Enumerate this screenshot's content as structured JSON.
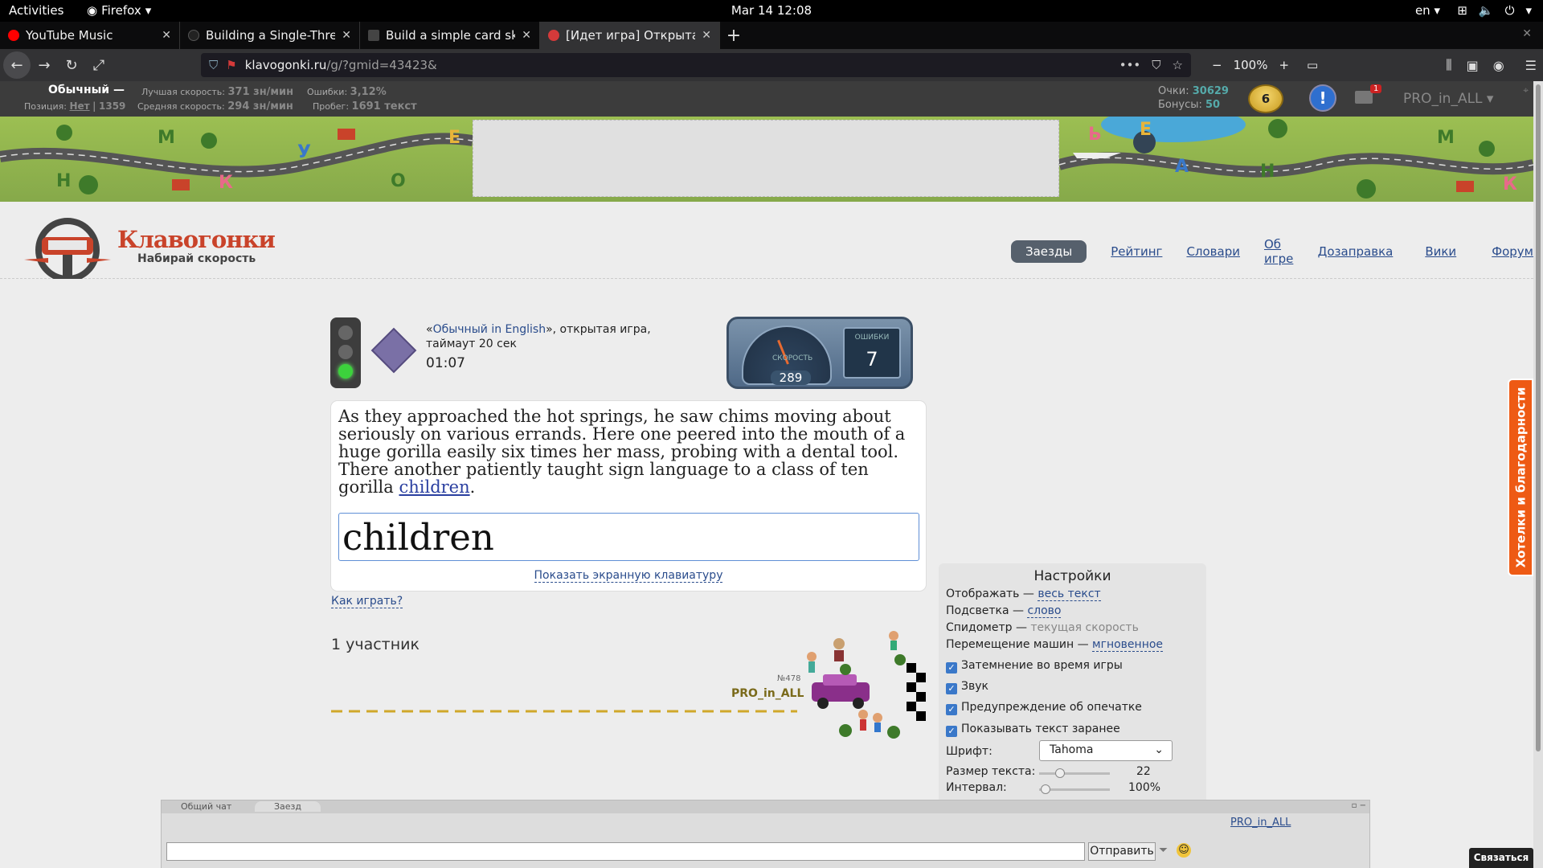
{
  "topbar": {
    "activities": "Activities",
    "app": "Firefox",
    "clock": "Mar 14  12:08",
    "lang": "en"
  },
  "tabs": [
    {
      "title": "YouTube Music",
      "color": "#ff0000"
    },
    {
      "title": "Building a Single-Thread",
      "color": "#222222"
    },
    {
      "title": "Build a simple card skelet",
      "color": "#444444"
    },
    {
      "title": "[Идет игра] Открытая и",
      "color": "#d43a3a"
    }
  ],
  "navbar": {
    "url_host": "klavogonki.ru",
    "url_path": "/g/?gmid=43423&",
    "zoom": "100%"
  },
  "stats": {
    "mode": "Обычный —",
    "position_label": "Позиция:",
    "position_value": "Нет",
    "position_extra": "1359",
    "best_speed_label": "Лучшая скорость:",
    "best_speed_value": "371 зн/мин",
    "avg_speed_label": "Средняя скорость:",
    "avg_speed_value": "294 зн/мин",
    "errors_label": "Ошибки:",
    "errors_value": "3,12%",
    "mileage_label": "Пробег:",
    "mileage_value": "1691 текст",
    "points_label": "Очки:",
    "points_value": "30629",
    "bonus_label": "Бонусы:",
    "bonus_value": "50",
    "level": "6",
    "mail_count": "1",
    "user": "PRO_in_ALL"
  },
  "banner": {
    "letters": [
      "М",
      "У",
      "Е",
      "Н",
      "К",
      "О",
      "Ь",
      "Е",
      "А",
      "К",
      "М",
      "Н"
    ]
  },
  "header": {
    "logo_title": "Клавогонки",
    "logo_sub": "Набирай скорость",
    "nav": [
      "Заезды",
      "Рейтинг",
      "Словари",
      "Об игре",
      "Дозаправка",
      "Вики",
      "Форум"
    ]
  },
  "game": {
    "desc_open_quote": "«",
    "desc_link": "Обычный in English",
    "desc_rest": "», открытая игра, таймаут 20 сек",
    "timer": "01:07",
    "speed_label": "СКОРОСТЬ",
    "speed": "289",
    "errors_label": "ОШИБКИ",
    "errors": "7",
    "passage_before": "As they approached the hot springs, he saw chims moving about seriously on various errands. Here one peered into the mouth of a huge gorilla easily six times her mass, probing with a dental tool. There another patiently taught sign language to a class of ten gorilla ",
    "passage_current": "children",
    "passage_after": ".",
    "input_value": "children",
    "keyboard_link": "Показать экранную клавиатуру",
    "how_to_play": "Как играть?",
    "participants": "1 участник",
    "player_name": "PRO_in_ALL",
    "player_rank": "№478"
  },
  "settings": {
    "title": "Настройки",
    "display_label": "Отображать —",
    "display_value": "весь текст",
    "highlight_label": "Подсветка —",
    "highlight_value": "слово",
    "speedo_label": "Спидометр —",
    "speedo_value": "текущая скорость",
    "movement_label": "Перемещение машин —",
    "movement_value": "мгновенное",
    "check_dim": "Затемнение во время игры",
    "check_sound": "Звук",
    "check_typo": "Предупреждение об опечатке",
    "check_preview": "Показывать текст заранее",
    "font_label": "Шрифт:",
    "font_value": "Tahoma",
    "size_label": "Размер текста:",
    "size_value": "22",
    "interval_label": "Интервал:",
    "interval_value": "100%"
  },
  "feedback": "Хотелки и благодарности",
  "chat": {
    "tab_general": "Общий чат",
    "tab_race": "Заезд",
    "send": "Отправить",
    "user": "PRO_in_ALL",
    "contact": "Связаться"
  }
}
